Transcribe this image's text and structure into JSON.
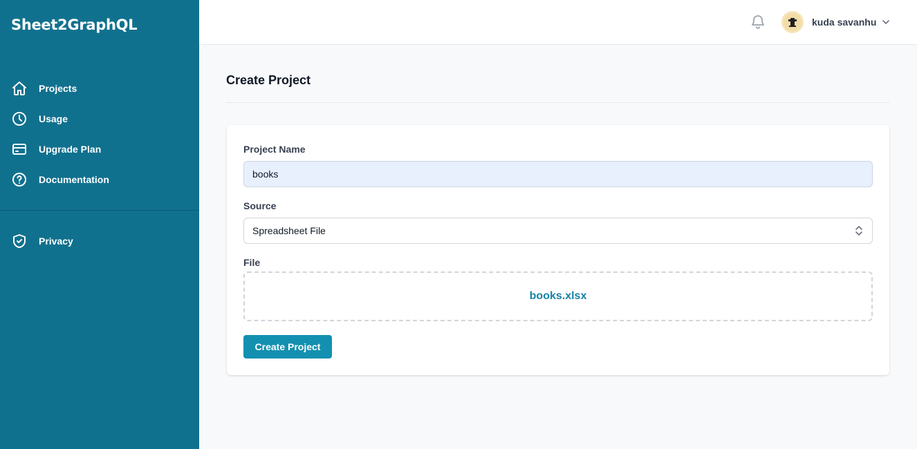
{
  "app": {
    "brand": "Sheet2GraphQL"
  },
  "sidebar": {
    "items": [
      {
        "label": "Projects",
        "icon": "home-icon"
      },
      {
        "label": "Usage",
        "icon": "clock-icon"
      },
      {
        "label": "Upgrade Plan",
        "icon": "credit-card-icon"
      },
      {
        "label": "Documentation",
        "icon": "question-circle-icon"
      }
    ],
    "secondary_items": [
      {
        "label": "Privacy",
        "icon": "shield-check-icon"
      }
    ]
  },
  "header": {
    "notifications_icon": "bell-icon",
    "user": {
      "name": "kuda savanhu",
      "avatar_icon": "avatar-icon",
      "menu_icon": "chevron-down-icon"
    }
  },
  "page": {
    "title": "Create Project"
  },
  "form": {
    "project_name": {
      "label": "Project Name",
      "value": "books"
    },
    "source": {
      "label": "Source",
      "value": "Spreadsheet File",
      "icon": "selector-icon"
    },
    "file": {
      "label": "File",
      "filename": "books.xlsx"
    },
    "submit_label": "Create Project"
  },
  "colors": {
    "sidebar_bg": "#10718e",
    "accent": "#1390b0",
    "link": "#1583a6",
    "input_filled_bg": "#e8f0fe"
  }
}
